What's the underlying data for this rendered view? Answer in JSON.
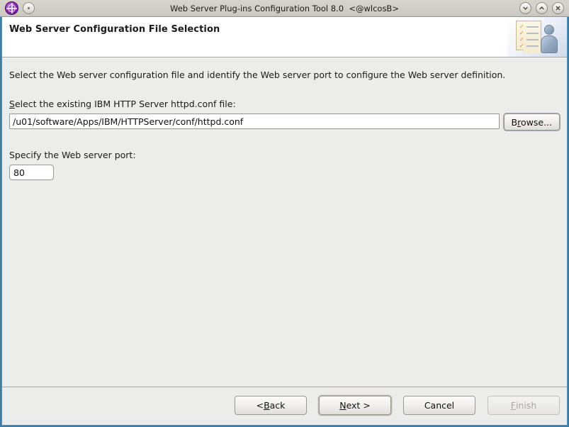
{
  "window": {
    "title": "Web Server Plug-ins Configuration Tool 8.0  <@wlcosB>",
    "app_icon": "globe-crosshair-icon",
    "controls": {
      "menu": "window-menu-dot",
      "minimize": "chevron-down-icon",
      "maximize": "chevron-up-icon",
      "close": "close-x-icon"
    }
  },
  "header": {
    "title": "Web Server Configuration File Selection",
    "art": {
      "document": "checklist-document-icon",
      "person": "person-figure-icon",
      "check_count": 4,
      "check_color": "#e8820c"
    }
  },
  "content": {
    "intro": "Select the Web server configuration file and identify the Web server port to configure the Web server definition.",
    "file_field": {
      "label_mnemonic": "S",
      "label_rest": "elect the existing IBM HTTP Server httpd.conf file:",
      "value": "/u01/software/Apps/IBM/HTTPServer/conf/httpd.conf",
      "placeholder": ""
    },
    "browse_button": {
      "pre": "B",
      "mnemonic": "r",
      "post": "owse..."
    },
    "port_field": {
      "label": "Specify the Web server port:",
      "value": "80",
      "placeholder": ""
    }
  },
  "footer": {
    "buttons": [
      {
        "name": "back-button",
        "pre": "< ",
        "mnemonic": "B",
        "post": "ack",
        "state": "enabled",
        "default": false
      },
      {
        "name": "next-button",
        "pre": "",
        "mnemonic": "N",
        "post": "ext >",
        "state": "enabled",
        "default": true
      },
      {
        "name": "cancel-button",
        "pre": "Cancel",
        "mnemonic": "",
        "post": "",
        "state": "enabled",
        "default": false
      },
      {
        "name": "finish-button",
        "pre": "",
        "mnemonic": "F",
        "post": "inish",
        "state": "disabled",
        "default": false
      }
    ]
  },
  "colors": {
    "window_frame": "#3c7ea5",
    "titlebar": "#d2cfc7",
    "header_band": "#ffffff",
    "content_bg": "#ececea",
    "accent_check": "#e8820c"
  }
}
